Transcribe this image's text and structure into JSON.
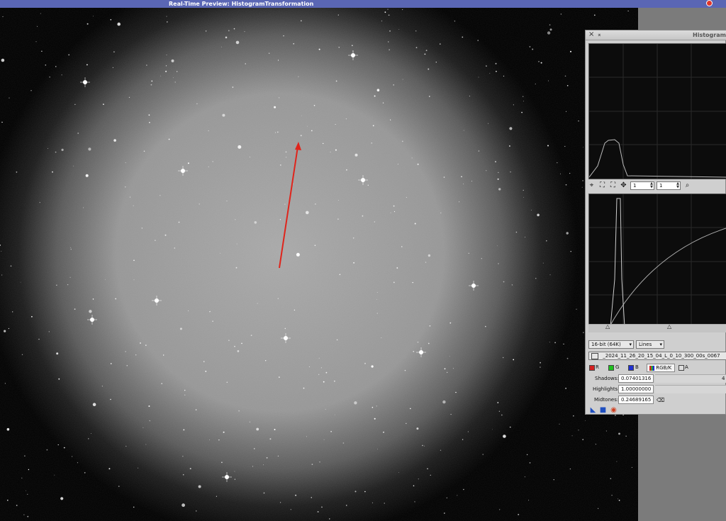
{
  "titlebar": {
    "title": "Real-Time Preview: HistogramTransformation"
  },
  "histogram_window": {
    "title": "HistogramTr",
    "zoom_h": "1",
    "zoom_v": "1",
    "bit_depth": "16-bit (64K)",
    "graph_style": "Lines",
    "view_name": "_2024_11_26_20_15_04_L_0_10_300_00s_0067",
    "channels": {
      "r": "R",
      "g": "G",
      "b": "B",
      "rgbk": "RGB/K",
      "a": "A"
    },
    "shadows_label": "Shadows:",
    "shadows_value": "0.07401316",
    "highlights_label": "Highlights:",
    "highlights_value": "1.00000000",
    "midtones_label": "Midtones:",
    "midtones_value": "0.24689165",
    "shadows_extra": "4"
  },
  "colors": {
    "titlebar": "#5a66b4",
    "arrow": "#e0241b",
    "red_channel": "#d42020",
    "green_channel": "#20c020",
    "blue_channel": "#2030d0"
  }
}
